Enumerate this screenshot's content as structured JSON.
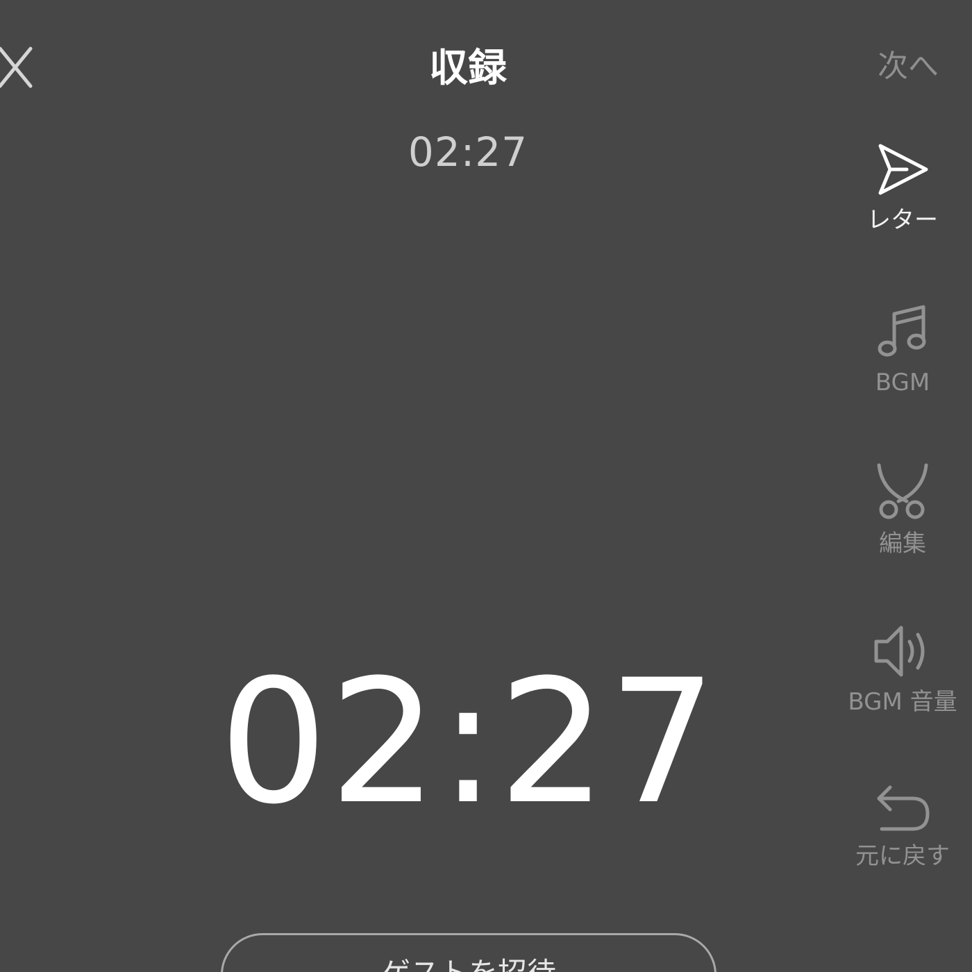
{
  "header": {
    "close_icon": "close-icon",
    "title": "収録",
    "next_label": "次へ"
  },
  "timer": {
    "elapsed_small": "02:27",
    "elapsed_large": "02:27"
  },
  "toolbar": {
    "items": [
      {
        "label": "レター",
        "icon": "send-icon",
        "state": "active"
      },
      {
        "label": "BGM",
        "icon": "music-note-icon",
        "state": "inactive"
      },
      {
        "label": "編集",
        "icon": "scissors-icon",
        "state": "inactive"
      },
      {
        "label": "BGM 音量",
        "icon": "speaker-icon",
        "state": "inactive"
      },
      {
        "label": "元に戻す",
        "icon": "undo-icon",
        "state": "inactive"
      }
    ]
  },
  "bottom": {
    "button_label": "ゲストを招待"
  },
  "colors": {
    "background": "#474747",
    "active": "#ffffff",
    "inactive": "#929292"
  }
}
